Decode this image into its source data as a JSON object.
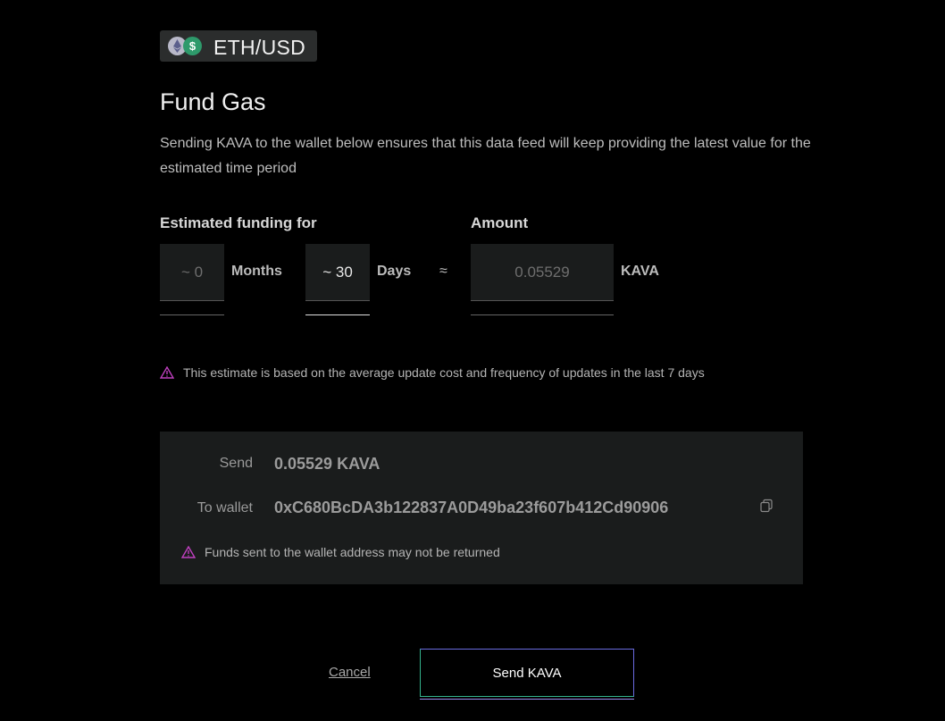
{
  "pair": {
    "label": "ETH/USD",
    "icons": [
      "ethereum-icon",
      "dollar-icon"
    ],
    "usd_symbol": "$"
  },
  "header": {
    "title": "Fund Gas",
    "description": "Sending KAVA to the wallet below ensures that this data feed will keep providing the latest value for the estimated time period"
  },
  "funding": {
    "label": "Estimated funding for",
    "months_value": "~ 0",
    "months_unit": "Months",
    "days_value": "~ 30",
    "days_unit": "Days",
    "approx_symbol": "≈",
    "amount_label": "Amount",
    "amount_value": "0.05529",
    "amount_unit": "KAVA"
  },
  "estimate_note": "This estimate is based on the average update cost and frequency of updates in the last 7 days",
  "send_panel": {
    "send_label": "Send",
    "send_value": "0.05529 KAVA",
    "wallet_label": "To wallet",
    "wallet_address": "0xC680BcDA3b122837A0D49ba23f607b412Cd90906",
    "warning": "Funds sent to the wallet address may not be returned"
  },
  "actions": {
    "cancel_label": "Cancel",
    "send_label": "Send KAVA"
  },
  "colors": {
    "warning": "#c040c0",
    "accent_green": "#34b38d",
    "accent_purple": "#6a6be0"
  }
}
